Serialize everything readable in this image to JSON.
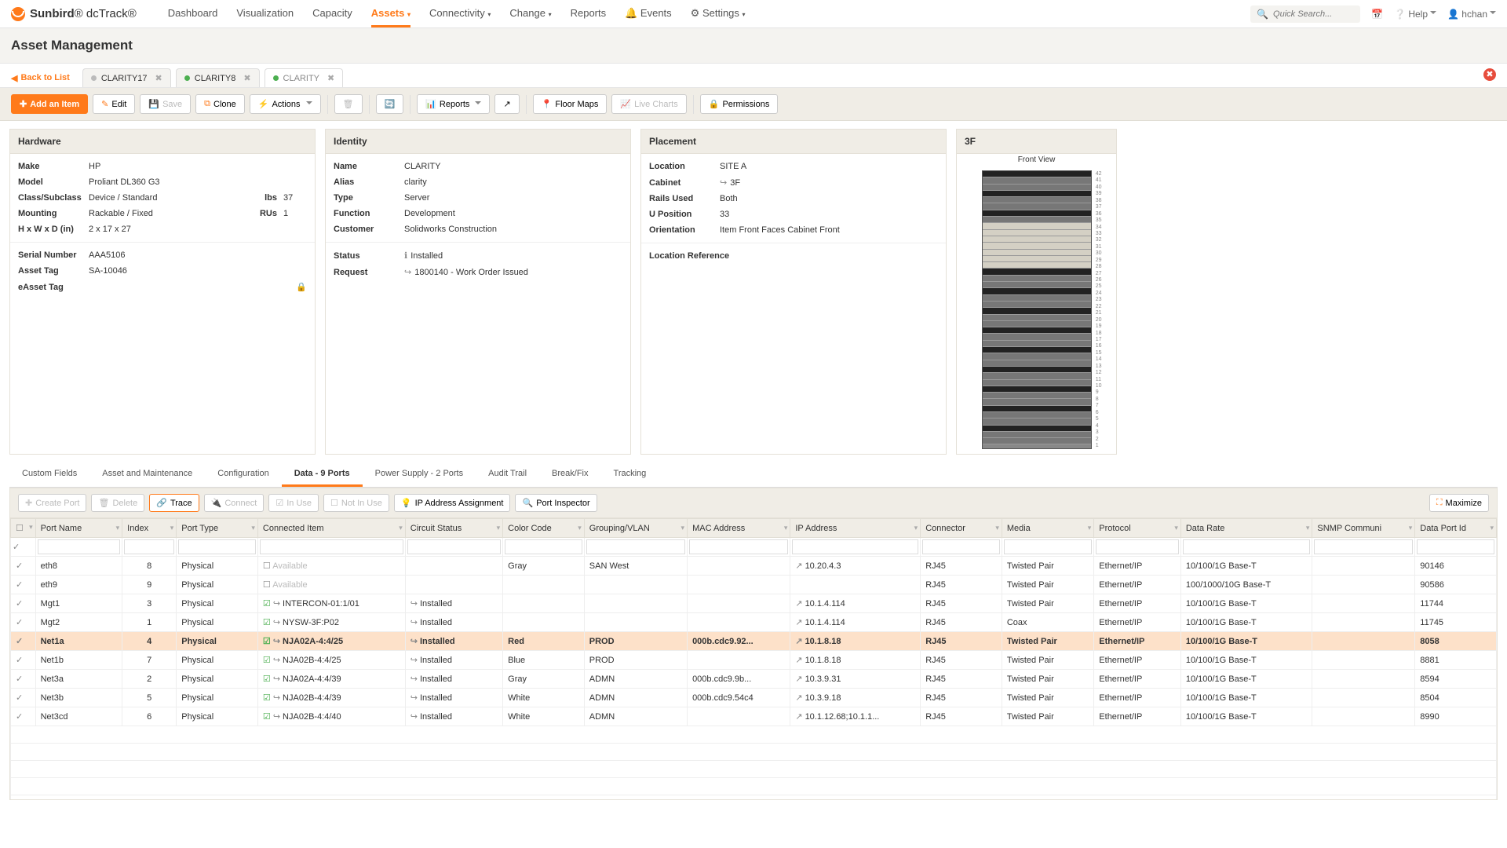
{
  "brand": {
    "a": "Sunbird",
    "b": "dcTrack",
    "reg": "®"
  },
  "nav": [
    "Dashboard",
    "Visualization",
    "Capacity",
    "Assets",
    "Connectivity",
    "Change",
    "Reports",
    "Events",
    "Settings"
  ],
  "search_placeholder": "Quick Search...",
  "help": "Help",
  "user": "hchan",
  "page_title": "Asset Management",
  "back": "Back to List",
  "doc_tabs": [
    {
      "t": "CLARITY17",
      "dot": "gray"
    },
    {
      "t": "CLARITY8",
      "dot": "green"
    },
    {
      "t": "CLARITY",
      "dot": "green",
      "active": true
    }
  ],
  "toolbar": {
    "add": "Add an Item",
    "edit": "Edit",
    "save": "Save",
    "clone": "Clone",
    "actions": "Actions",
    "reports": "Reports",
    "floor": "Floor Maps",
    "live": "Live Charts",
    "perm": "Permissions"
  },
  "hw": {
    "title": "Hardware",
    "make": "HP",
    "model": "Proliant DL360 G3",
    "class": "Device / Standard",
    "lbs": "37",
    "mount": "Rackable / Fixed",
    "rus": "1",
    "dims": "2 x 17 x 27",
    "serial": "AAA5106",
    "asset": "SA-10046",
    "easset": ""
  },
  "hw_labels": {
    "make": "Make",
    "model": "Model",
    "class": "Class/Subclass",
    "lbs": "lbs",
    "mount": "Mounting",
    "rus": "RUs",
    "dims": "H x W x D (in)",
    "serial": "Serial Number",
    "asset": "Asset Tag",
    "easset": "eAsset Tag"
  },
  "id": {
    "title": "Identity",
    "name": "CLARITY",
    "alias": "clarity",
    "type": "Server",
    "func": "Development",
    "cust": "Solidworks Construction",
    "status": "Installed",
    "req": "1800140 - Work Order Issued"
  },
  "id_labels": {
    "name": "Name",
    "alias": "Alias",
    "type": "Type",
    "func": "Function",
    "cust": "Customer",
    "status": "Status",
    "req": "Request"
  },
  "pl": {
    "title": "Placement",
    "loc": "SITE A",
    "cab": "3F",
    "rails": "Both",
    "upos": "33",
    "orient": "Item Front Faces Cabinet Front",
    "locref_label": "Location Reference"
  },
  "pl_labels": {
    "loc": "Location",
    "cab": "Cabinet",
    "rails": "Rails Used",
    "upos": "U Position",
    "orient": "Orientation"
  },
  "rack": {
    "title": "3F",
    "view": "Front View"
  },
  "subtabs": [
    "Custom Fields",
    "Asset and Maintenance",
    "Configuration",
    "Data - 9 Ports",
    "Power Supply - 2 Ports",
    "Audit Trail",
    "Break/Fix",
    "Tracking"
  ],
  "gridbar": {
    "create": "Create Port",
    "del": "Delete",
    "trace": "Trace",
    "connect": "Connect",
    "inuse": "In Use",
    "notinuse": "Not In Use",
    "ipa": "IP Address Assignment",
    "pi": "Port Inspector",
    "max": "Maximize"
  },
  "cols": [
    "",
    "Port Name",
    "Index",
    "Port Type",
    "Connected Item",
    "Circuit Status",
    "Color Code",
    "Grouping/VLAN",
    "MAC Address",
    "IP Address",
    "Connector",
    "Media",
    "Protocol",
    "Data Rate",
    "SNMP Communi",
    "Data Port Id"
  ],
  "rows": [
    {
      "pn": "eth8",
      "idx": "8",
      "pt": "Physical",
      "ci": "Available",
      "ci_avail": true,
      "cs": "",
      "cc": "Gray",
      "gv": "SAN West",
      "mac": "",
      "ip": "10.20.4.3",
      "conn": "RJ45",
      "media": "Twisted Pair",
      "proto": "Ethernet/IP",
      "dr": "10/100/1G Base-T",
      "dpid": "90146"
    },
    {
      "pn": "eth9",
      "idx": "9",
      "pt": "Physical",
      "ci": "Available",
      "ci_avail": true,
      "cs": "",
      "cc": "",
      "gv": "",
      "mac": "",
      "ip": "",
      "conn": "RJ45",
      "media": "Twisted Pair",
      "proto": "Ethernet/IP",
      "dr": "100/1000/10G Base-T",
      "dpid": "90586"
    },
    {
      "pn": "Mgt1",
      "idx": "3",
      "pt": "Physical",
      "ci": "INTERCON-01:1/01",
      "cs": "Installed",
      "cc": "",
      "gv": "",
      "mac": "",
      "ip": "10.1.4.114",
      "conn": "RJ45",
      "media": "Twisted Pair",
      "proto": "Ethernet/IP",
      "dr": "10/100/1G Base-T",
      "dpid": "11744"
    },
    {
      "pn": "Mgt2",
      "idx": "1",
      "pt": "Physical",
      "ci": "NYSW-3F:P02",
      "cs": "Installed",
      "cc": "",
      "gv": "",
      "mac": "",
      "ip": "10.1.4.114",
      "conn": "RJ45",
      "media": "Coax",
      "proto": "Ethernet/IP",
      "dr": "10/100/1G Base-T",
      "dpid": "11745"
    },
    {
      "pn": "Net1a",
      "idx": "4",
      "pt": "Physical",
      "ci": "NJA02A-4:4/25",
      "cs": "Installed",
      "cc": "Red",
      "gv": "PROD",
      "mac": "000b.cdc9.92...",
      "ip": "10.1.8.18",
      "conn": "RJ45",
      "media": "Twisted Pair",
      "proto": "Ethernet/IP",
      "dr": "10/100/1G Base-T",
      "dpid": "8058",
      "sel": true
    },
    {
      "pn": "Net1b",
      "idx": "7",
      "pt": "Physical",
      "ci": "NJA02B-4:4/25",
      "cs": "Installed",
      "cc": "Blue",
      "gv": "PROD",
      "mac": "",
      "ip": "10.1.8.18",
      "conn": "RJ45",
      "media": "Twisted Pair",
      "proto": "Ethernet/IP",
      "dr": "10/100/1G Base-T",
      "dpid": "8881"
    },
    {
      "pn": "Net3a",
      "idx": "2",
      "pt": "Physical",
      "ci": "NJA02A-4:4/39",
      "cs": "Installed",
      "cc": "Gray",
      "gv": "ADMN",
      "mac": "000b.cdc9.9b...",
      "ip": "10.3.9.31",
      "conn": "RJ45",
      "media": "Twisted Pair",
      "proto": "Ethernet/IP",
      "dr": "10/100/1G Base-T",
      "dpid": "8594"
    },
    {
      "pn": "Net3b",
      "idx": "5",
      "pt": "Physical",
      "ci": "NJA02B-4:4/39",
      "cs": "Installed",
      "cc": "White",
      "gv": "ADMN",
      "mac": "000b.cdc9.54c4",
      "ip": "10.3.9.18",
      "conn": "RJ45",
      "media": "Twisted Pair",
      "proto": "Ethernet/IP",
      "dr": "10/100/1G Base-T",
      "dpid": "8504"
    },
    {
      "pn": "Net3cd",
      "idx": "6",
      "pt": "Physical",
      "ci": "NJA02B-4:4/40",
      "cs": "Installed",
      "cc": "White",
      "gv": "ADMN",
      "mac": "",
      "ip": "10.1.12.68;10.1.1...",
      "conn": "RJ45",
      "media": "Twisted Pair",
      "proto": "Ethernet/IP",
      "dr": "10/100/1G Base-T",
      "dpid": "8990"
    }
  ]
}
